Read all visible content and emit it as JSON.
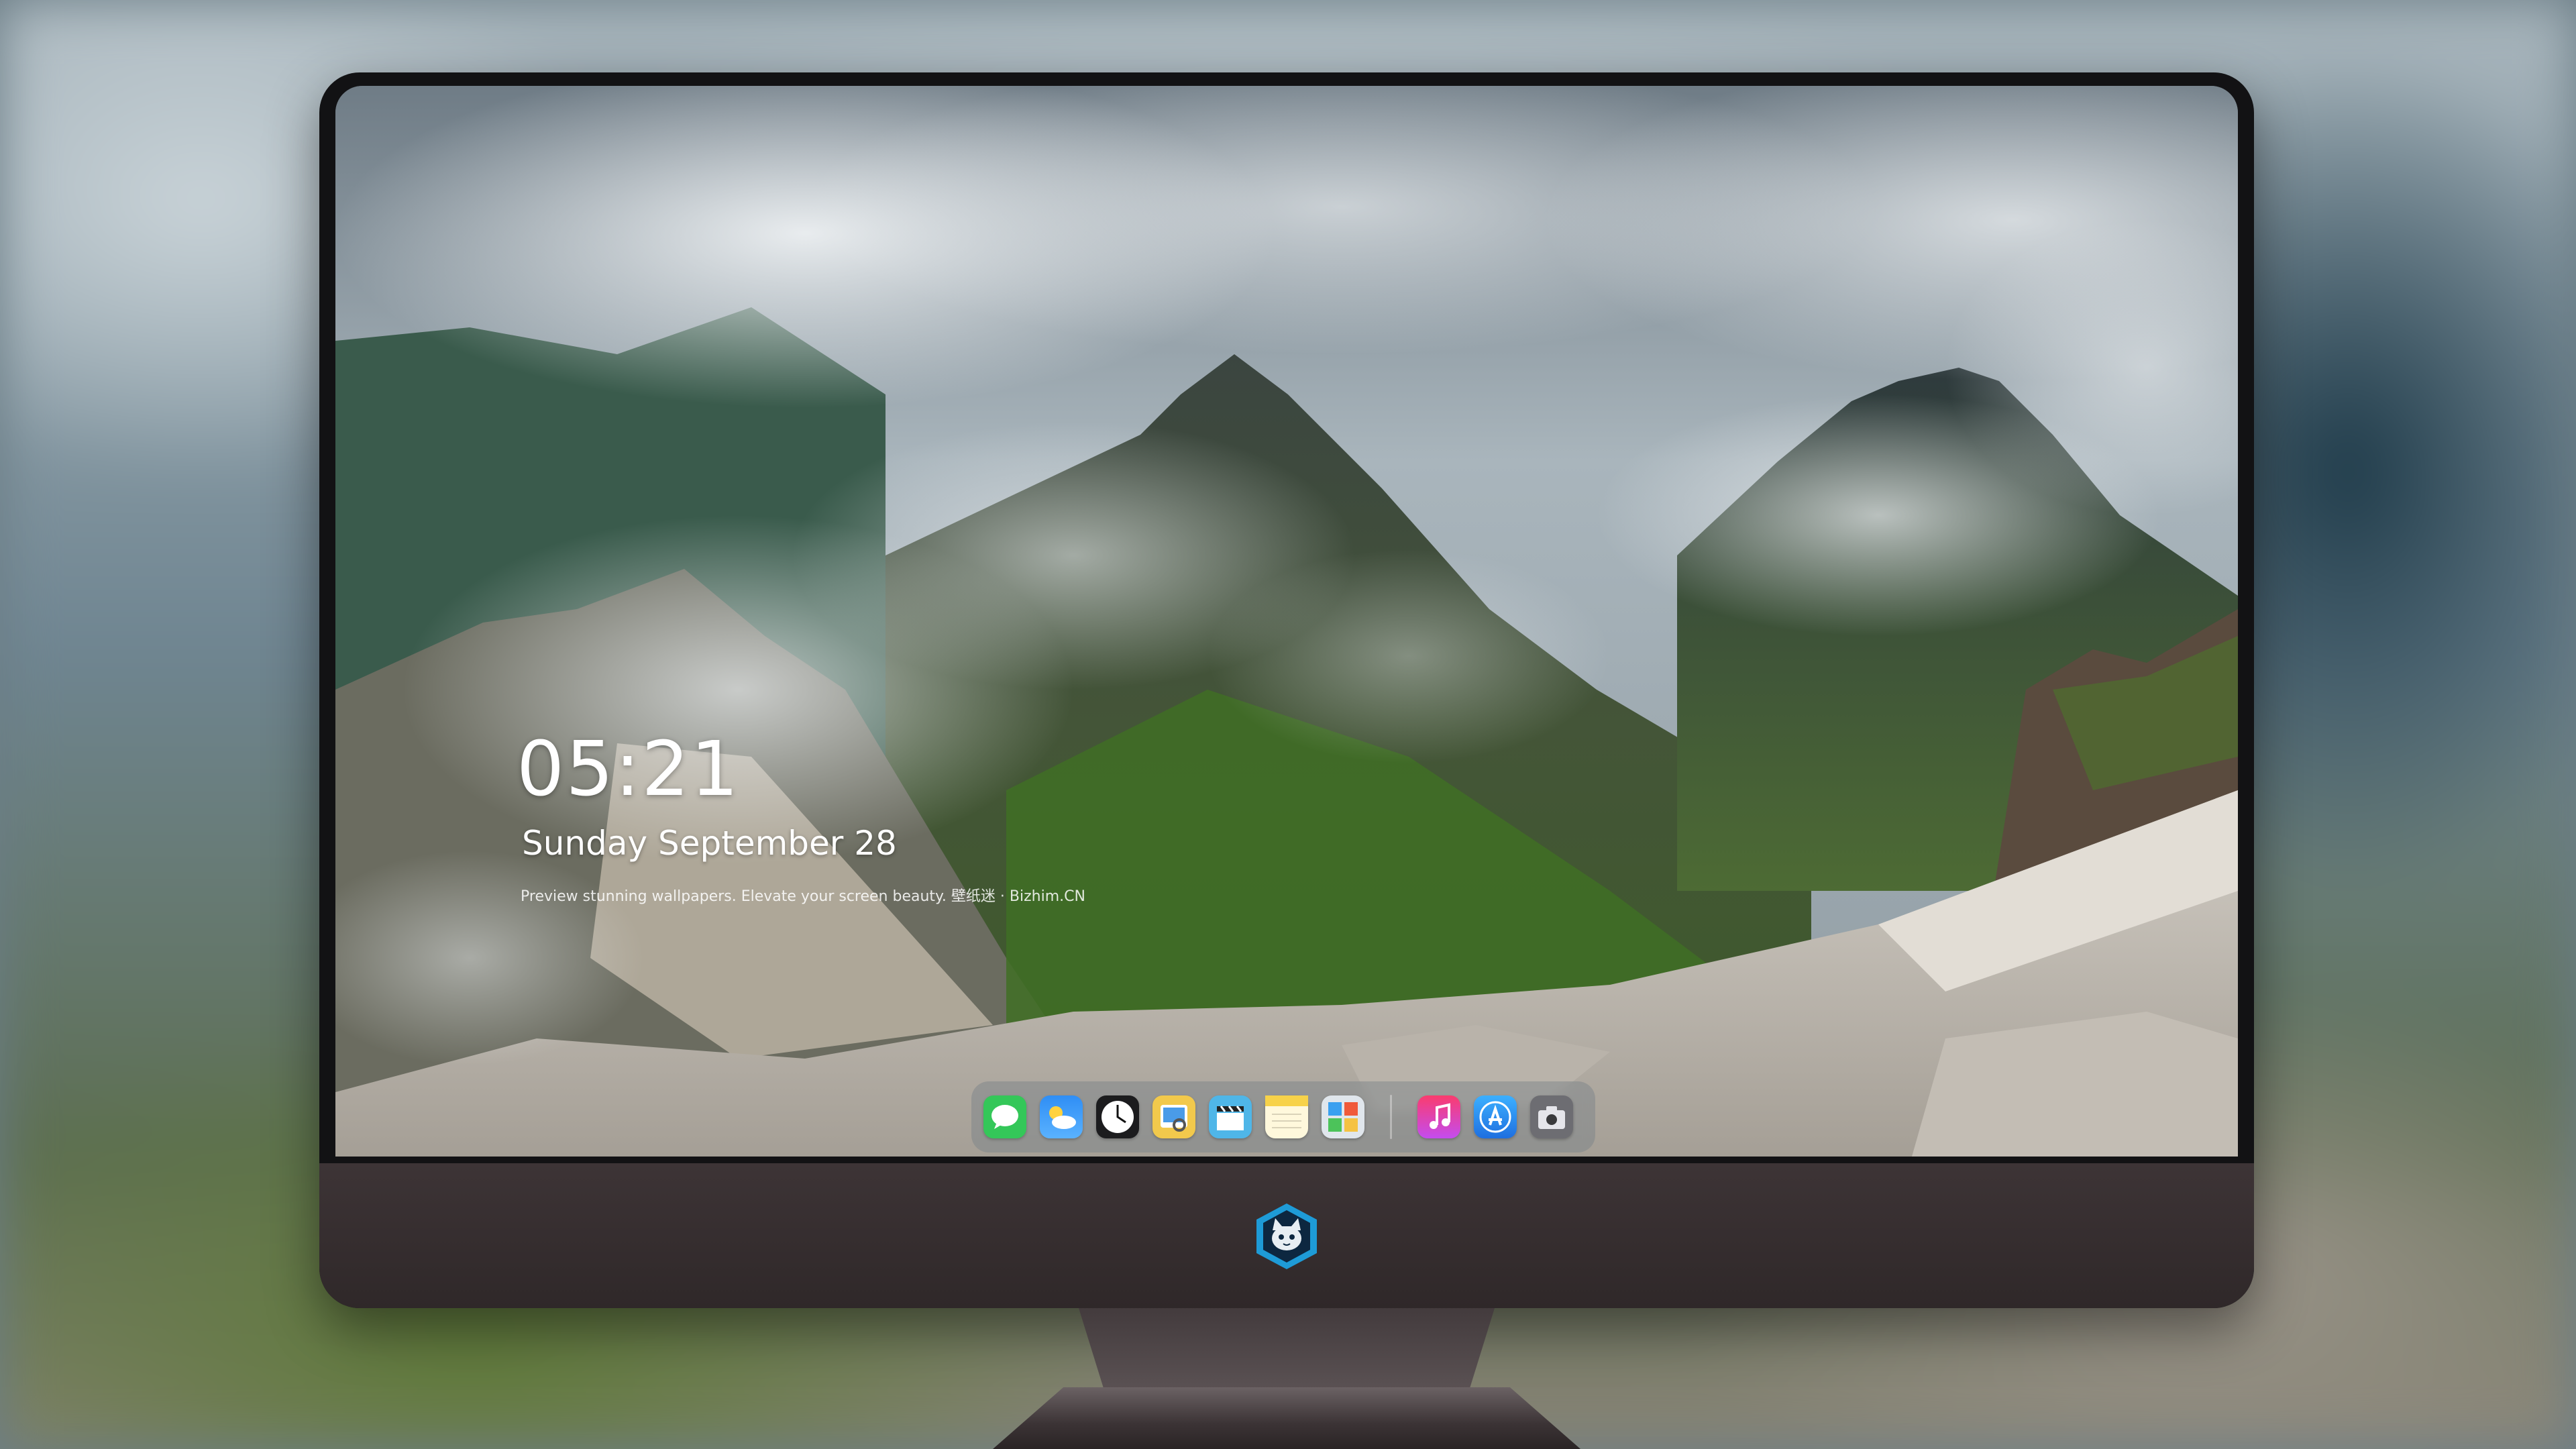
{
  "lockscreen": {
    "time": "05:21",
    "date": "Sunday September 28",
    "caption": "Preview stunning wallpapers. Elevate your screen beauty. 壁纸迷 · Bizhim.CN"
  },
  "dock": {
    "apps": [
      {
        "name": "Messages",
        "icon": "messages-icon",
        "color": "#34c759"
      },
      {
        "name": "Weather",
        "icon": "weather-icon",
        "color": "#2f8ef5"
      },
      {
        "name": "Clock",
        "icon": "clock-icon",
        "color": "#1c1c1e"
      },
      {
        "name": "Preview",
        "icon": "preview-icon",
        "color": "#f2c94c"
      },
      {
        "name": "Clips",
        "icon": "clapperboard-icon",
        "color": "#4fb6e8"
      },
      {
        "name": "Notes",
        "icon": "notes-icon",
        "color": "#f7d24a"
      },
      {
        "name": "Photo Booth",
        "icon": "photos-icon",
        "color": "#e0e6ec"
      },
      {
        "name": "Music",
        "icon": "music-icon",
        "color": "#fa3c6e"
      },
      {
        "name": "App Store",
        "icon": "app-store-icon",
        "color": "#1e90ff"
      },
      {
        "name": "Camera",
        "icon": "camera-icon",
        "color": "#6d6d72"
      }
    ]
  },
  "brand": {
    "logo": "cat-mascot-logo"
  }
}
